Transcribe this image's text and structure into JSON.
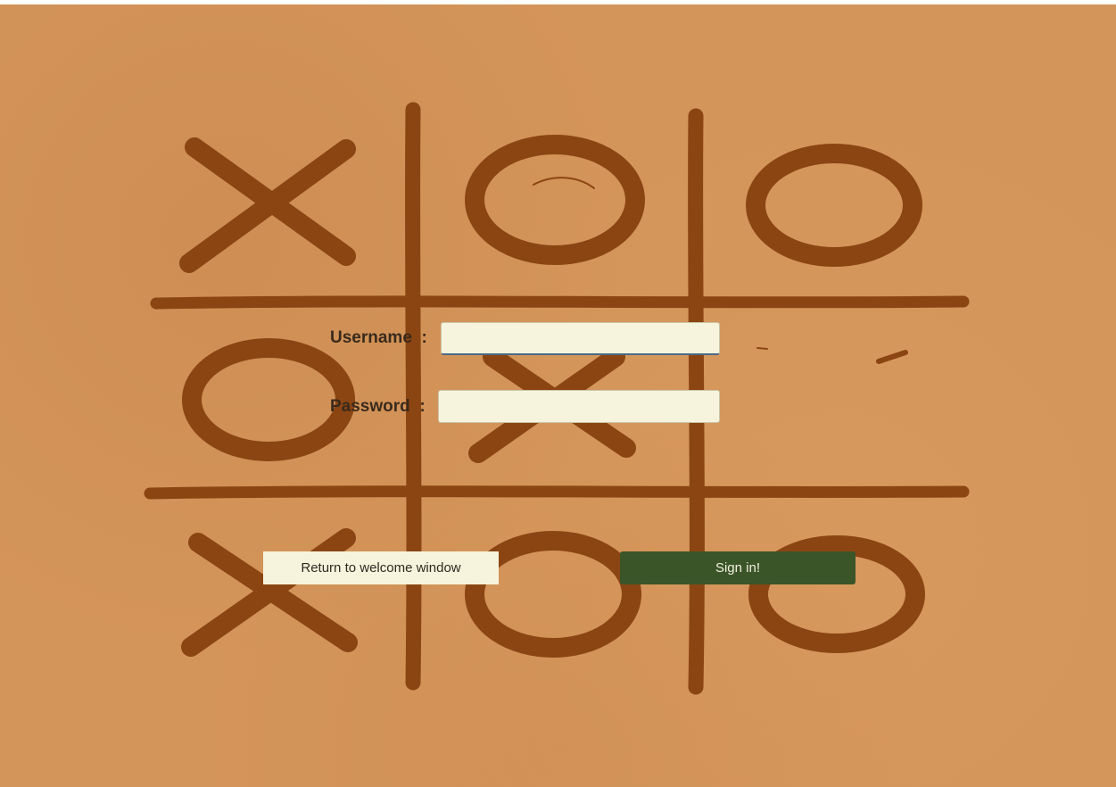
{
  "login_form": {
    "username_label": "Username  :",
    "password_label": "Password  :",
    "username_value": "",
    "password_value": ""
  },
  "buttons": {
    "return_label": "Return to welcome window",
    "signin_label": "Sign in!"
  },
  "board": {
    "cells": [
      "X",
      "O",
      "O",
      "O",
      "X",
      "",
      "X",
      "O",
      "O"
    ]
  },
  "colors": {
    "background": "#d4955a",
    "ink": "#8b4513",
    "input_bg": "#f6f4dc",
    "signin_bg": "#3a5528",
    "return_bg": "#f6f4dc"
  }
}
